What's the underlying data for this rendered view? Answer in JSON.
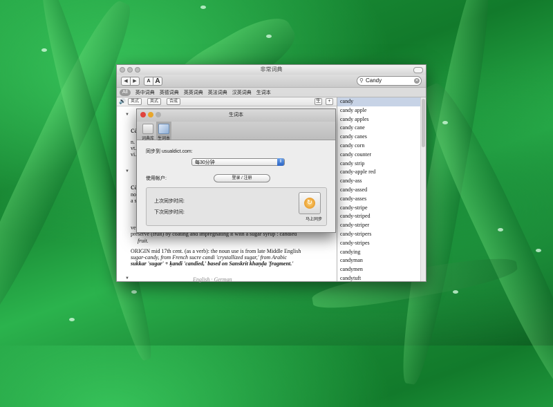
{
  "window": {
    "title": "非常词典",
    "search_value": "Candy",
    "font_small": "A",
    "font_large": "A",
    "back_glyph": "◀",
    "forward_glyph": "▶"
  },
  "dictionary_tabs": [
    "All",
    "英中词典",
    "英德词典",
    "英英词典",
    "英法词典",
    "汉英词典",
    "生词本"
  ],
  "pron_bar": {
    "british_label": "英式",
    "american_label": "英式",
    "combined_label": "合成",
    "new_word_label": "生",
    "add_label": "+"
  },
  "definition": {
    "headword1": "ca",
    "headword2": "ca",
    "lines_top": [
      "n.",
      "vt.",
      "vi."
    ],
    "lines_mid": [
      "no",
      "a s"
    ],
    "verb_line": "ver",
    "preserve_line": "preserve (fruit) by coating and impregnating it with a sugar syrup : candied",
    "fruit": "fruit.",
    "origin_line1": "ORIGIN mid 17th cent. (as a verb): the noun use is from late Middle English",
    "origin_line2": "sugar-candy, from French sucre candi 'crystallized sugar,' from Arabic",
    "origin_line3": "sukkar 'sugar' + ḳandī 'candied,' based on Sanskrit khaṇḍa 'fragment.'",
    "section_footer": "English · German"
  },
  "word_list": [
    "candy",
    "candy apple",
    "candy apples",
    "candy cane",
    "candy canes",
    "candy corn",
    "candy counter",
    "candy strip",
    "candy-apple red",
    "candy-ass",
    "candy-assed",
    "candy-asses",
    "candy-stripe",
    "candy-striped",
    "candy-striper",
    "candy-stripers",
    "candy-stripes",
    "candying",
    "candyman",
    "candymen",
    "candytuft"
  ],
  "selected_word_index": 0,
  "dialog": {
    "title": "生词本",
    "tab_library": "词典库",
    "tab_vocab": "生词本",
    "sync_to_label": "同步到 usualdict.com:",
    "interval_value": "每30分钟",
    "account_label": "使用帐户:",
    "login_label": "登录 / 注册",
    "last_sync_label": "上次同步时间:",
    "next_sync_label": "下次同步时间:",
    "sync_now_label": "马上同步"
  },
  "colors": {
    "selection": "#c7d3e6",
    "close_red": "#e0443e",
    "minimize_yellow": "#e8a62a",
    "zoom_gray": "#b0b0b0"
  }
}
